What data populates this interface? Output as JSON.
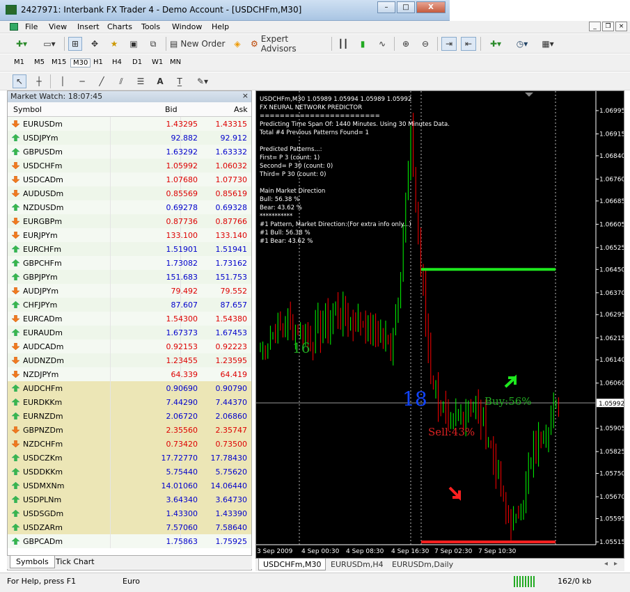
{
  "window": {
    "title": "2427971: Interbank FX Trader 4 - Demo Account - [USDCHFm,M30]",
    "min": "–",
    "max": "□",
    "close": "X"
  },
  "menu": [
    "File",
    "View",
    "Insert",
    "Charts",
    "Tools",
    "Window",
    "Help"
  ],
  "toolbar": {
    "new_order": "New Order",
    "expert_advisors": "Expert Advisors"
  },
  "timeframes": [
    "M1",
    "M5",
    "M15",
    "M30",
    "H1",
    "H4",
    "D1",
    "W1",
    "MN"
  ],
  "market_watch": {
    "title": "Market Watch: 18:07:45",
    "close": "×",
    "col_symbol": "Symbol",
    "col_bid": "Bid",
    "col_ask": "Ask",
    "rows": [
      {
        "symbol": "EURUSDm",
        "bid": "1.43295",
        "ask": "1.43315",
        "dir": "down",
        "hl": false
      },
      {
        "symbol": "USDJPYm",
        "bid": "92.882",
        "ask": "92.912",
        "dir": "up",
        "hl": false
      },
      {
        "symbol": "GBPUSDm",
        "bid": "1.63292",
        "ask": "1.63332",
        "dir": "up",
        "hl": false
      },
      {
        "symbol": "USDCHFm",
        "bid": "1.05992",
        "ask": "1.06032",
        "dir": "down",
        "hl": false
      },
      {
        "symbol": "USDCADm",
        "bid": "1.07680",
        "ask": "1.07730",
        "dir": "down",
        "hl": false
      },
      {
        "symbol": "AUDUSDm",
        "bid": "0.85569",
        "ask": "0.85619",
        "dir": "down",
        "hl": false
      },
      {
        "symbol": "NZDUSDm",
        "bid": "0.69278",
        "ask": "0.69328",
        "dir": "up",
        "hl": false
      },
      {
        "symbol": "EURGBPm",
        "bid": "0.87736",
        "ask": "0.87766",
        "dir": "down",
        "hl": false
      },
      {
        "symbol": "EURJPYm",
        "bid": "133.100",
        "ask": "133.140",
        "dir": "down",
        "hl": false
      },
      {
        "symbol": "EURCHFm",
        "bid": "1.51901",
        "ask": "1.51941",
        "dir": "up",
        "hl": false
      },
      {
        "symbol": "GBPCHFm",
        "bid": "1.73082",
        "ask": "1.73162",
        "dir": "up",
        "hl": false
      },
      {
        "symbol": "GBPJPYm",
        "bid": "151.683",
        "ask": "151.753",
        "dir": "up",
        "hl": false
      },
      {
        "symbol": "AUDJPYm",
        "bid": "79.492",
        "ask": "79.552",
        "dir": "down",
        "hl": false
      },
      {
        "symbol": "CHFJPYm",
        "bid": "87.607",
        "ask": "87.657",
        "dir": "up",
        "hl": false
      },
      {
        "symbol": "EURCADm",
        "bid": "1.54300",
        "ask": "1.54380",
        "dir": "down",
        "hl": false
      },
      {
        "symbol": "EURAUDm",
        "bid": "1.67373",
        "ask": "1.67453",
        "dir": "up",
        "hl": false
      },
      {
        "symbol": "AUDCADm",
        "bid": "0.92153",
        "ask": "0.92223",
        "dir": "down",
        "hl": false
      },
      {
        "symbol": "AUDNZDm",
        "bid": "1.23455",
        "ask": "1.23595",
        "dir": "down",
        "hl": false
      },
      {
        "symbol": "NZDJPYm",
        "bid": "64.339",
        "ask": "64.419",
        "dir": "down",
        "hl": false
      },
      {
        "symbol": "AUDCHFm",
        "bid": "0.90690",
        "ask": "0.90790",
        "dir": "up",
        "hl": true
      },
      {
        "symbol": "EURDKKm",
        "bid": "7.44290",
        "ask": "7.44370",
        "dir": "up",
        "hl": true
      },
      {
        "symbol": "EURNZDm",
        "bid": "2.06720",
        "ask": "2.06860",
        "dir": "up",
        "hl": true
      },
      {
        "symbol": "GBPNZDm",
        "bid": "2.35560",
        "ask": "2.35747",
        "dir": "down",
        "hl": true
      },
      {
        "symbol": "NZDCHFm",
        "bid": "0.73420",
        "ask": "0.73500",
        "dir": "down",
        "hl": true
      },
      {
        "symbol": "USDCZKm",
        "bid": "17.72770",
        "ask": "17.78430",
        "dir": "up",
        "hl": true
      },
      {
        "symbol": "USDDKKm",
        "bid": "5.75440",
        "ask": "5.75620",
        "dir": "up",
        "hl": true
      },
      {
        "symbol": "USDMXNm",
        "bid": "14.01060",
        "ask": "14.06440",
        "dir": "up",
        "hl": true
      },
      {
        "symbol": "USDPLNm",
        "bid": "3.64340",
        "ask": "3.64730",
        "dir": "up",
        "hl": true
      },
      {
        "symbol": "USDSGDm",
        "bid": "1.43300",
        "ask": "1.43390",
        "dir": "up",
        "hl": true
      },
      {
        "symbol": "USDZARm",
        "bid": "7.57060",
        "ask": "7.58640",
        "dir": "up",
        "hl": true
      },
      {
        "symbol": "GBPCADm",
        "bid": "1.75863",
        "ask": "1.75925",
        "dir": "up",
        "hl": false
      }
    ],
    "tabs": [
      "Symbols",
      "Tick Chart"
    ]
  },
  "chart": {
    "info_lines": [
      "USDCHFm,M30  1.05989 1.05994 1.05989 1.05992",
      "FX NEURAL NETWORK PREDICTOR",
      "========================",
      "Predicting Time Span Of: 1440 Minutes. Using 30 Minutes Data.",
      "Total #4 Previous Patterns Found= 1",
      "",
      "Predicted Patterns...:",
      "First= P 3  (count: 1)",
      "Second= P 30  (count: 0)",
      "Third= P 30  (count: 0)",
      "",
      "Main Market Direction",
      "Bull: 56.38 %",
      "Bear: 43.62 %",
      "***********",
      "#1 Pattern, Market Direction:(For extra info only...)",
      "#1 Bull: 56.38 %",
      "#1 Bear: 43.62 %"
    ],
    "price_labels": [
      "1.06995",
      "1.06915",
      "1.06840",
      "1.06760",
      "1.06685",
      "1.06605",
      "1.06525",
      "1.06450",
      "1.06370",
      "1.06295",
      "1.06215",
      "1.06140",
      "1.06060",
      "1.05992",
      "1.05905",
      "1.05825",
      "1.05750",
      "1.05670",
      "1.05595",
      "1.05515"
    ],
    "current_price": "1.05992",
    "time_labels": [
      "3 Sep 2009",
      "4 Sep 00:30",
      "4 Sep 08:30",
      "4 Sep 16:30",
      "7 Sep 02:30",
      "7 Sep 10:30"
    ],
    "label16": "16",
    "label18": "18",
    "buy_label": "Buy:56%",
    "sell_label": "Sell:43%",
    "colors": {
      "bull": "#00ff00",
      "bear": "#ff0000",
      "buy": "#22aa22",
      "sell": "#dd2222",
      "num16": "#22aa22",
      "num18": "#1144ff"
    }
  },
  "chart_tabs": [
    "USDCHFm,M30",
    "EURUSDm,H4",
    "EURUSDm,Daily"
  ],
  "status": {
    "help": "For Help, press F1",
    "profile": "Euro",
    "traffic": "162/0 kb"
  }
}
